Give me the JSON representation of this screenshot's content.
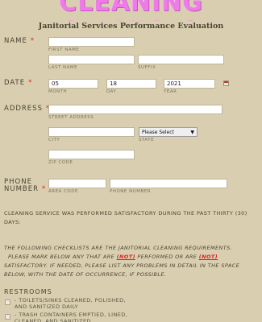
{
  "banner": {
    "text": "Cleaning Services"
  },
  "form_title": "Janitorial Services Performance Evaluation",
  "required_mark": "*",
  "name": {
    "label": "Name",
    "first_label": "First Name",
    "last_label": "Last Name",
    "suffix_label": "Suffix",
    "first_value": "",
    "last_value": "",
    "suffix_value": ""
  },
  "date": {
    "label": "Date",
    "month_value": "05",
    "day_value": "18",
    "year_value": "2021",
    "month_label": "Month",
    "day_label": "Day",
    "year_label": "Year",
    "calendar_icon": "calendar-icon"
  },
  "address": {
    "label": "Address",
    "street_label": "Street Address",
    "city_label": "City",
    "state_label": "State",
    "zip_label": "Zip Code",
    "state_selected": "Please Select"
  },
  "phone": {
    "label_line1": "Phone",
    "label_line2": "Number",
    "area_label": "Area Code",
    "number_label": "Phone Number"
  },
  "statement": "Cleaning service was performed satisfactory during the past thirty (30) days:",
  "instructions": {
    "line1": "The following checklists are the janitorial cleaning requirements.",
    "line2_before": "Please mark below any that are",
    "not_word": "(NOT)",
    "line2_mid": "performed or are",
    "line3_after": "satisfactory. If needed, please list any problems in detail in the space",
    "line4": "below, with the date of occurrence, if possible."
  },
  "restrooms": {
    "heading": "Restrooms",
    "items": [
      "- Toilets/sinks cleaned, polished, and sanitized daily",
      "- Trash containers emptied, lined, cleaned, and sanitized"
    ]
  }
}
